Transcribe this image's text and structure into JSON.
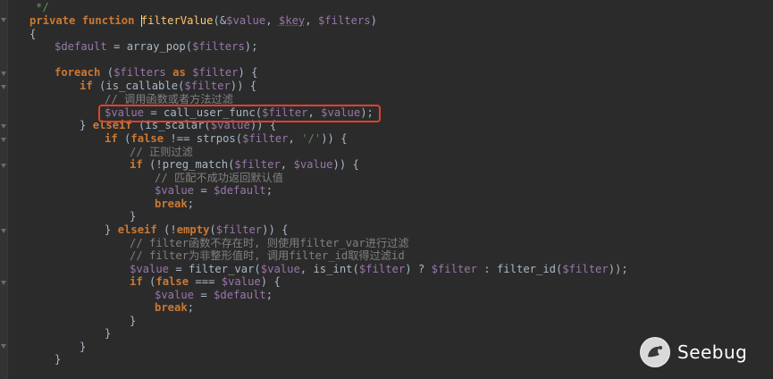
{
  "code": {
    "l0_comment_end": "*/",
    "l1_private": "private",
    "l1_function": "function",
    "l1_name": "filterValue",
    "l1_open": "(&",
    "l1_value": "$value",
    "l1_comma1": ", ",
    "l1_key": "$key",
    "l1_comma2": ", ",
    "l1_filters": "$filters",
    "l1_close": ")",
    "l2_brace": "{",
    "l3_default": "$default",
    "l3_assign": " = array_pop(",
    "l3_filters": "$filters",
    "l3_end": ");",
    "l4_foreach": "foreach",
    "l4_open": " (",
    "l4_filters": "$filters",
    "l4_as": " as ",
    "l4_filter": "$filter",
    "l4_end": ") {",
    "l5_if": "if",
    "l5_open": " (is_callable(",
    "l5_filter": "$filter",
    "l5_end": ")) {",
    "l6_comment": "// 调用函数或者方法过滤",
    "l7_value": "$value",
    "l7_mid": " = call_user_func(",
    "l7_filter": "$filter",
    "l7_comma": ", ",
    "l7_value2": "$value",
    "l7_end": ");",
    "l8_brace": "} ",
    "l8_elseif": "elseif",
    "l8_open": " (is_scalar(",
    "l8_value": "$value",
    "l8_end": ")) {",
    "l9_if": "if",
    "l9_open": " (",
    "l9_false": "false",
    "l9_mid": " !== strpos(",
    "l9_filter": "$filter",
    "l9_comma": ", ",
    "l9_str": "'/'",
    "l9_end": ")) {",
    "l10_comment": "// 正则过滤",
    "l11_if": "if",
    "l11_open": " (!preg_match(",
    "l11_filter": "$filter",
    "l11_comma": ", ",
    "l11_value": "$value",
    "l11_end": ")) {",
    "l12_comment": "// 匹配不成功返回默认值",
    "l13_value": "$value",
    "l13_mid": " = ",
    "l13_default": "$default",
    "l13_end": ";",
    "l14_break": "break",
    "l14_end": ";",
    "l15_brace": "}",
    "l16_brace": "} ",
    "l16_elseif": "elseif",
    "l16_open": " (!",
    "l16_empty": "empty",
    "l16_paren": "(",
    "l16_filter": "$filter",
    "l16_end": ")) {",
    "l17_comment": "// filter函数不存在时, 则使用filter_var进行过滤",
    "l18_comment": "// filter为非整形值时, 调用filter_id取得过滤id",
    "l19_value": "$value",
    "l19_mid": " = filter_var(",
    "l19_value2": "$value",
    "l19_mid2": ", is_int(",
    "l19_filter": "$filter",
    "l19_mid3": ") ? ",
    "l19_filter2": "$filter",
    "l19_mid4": " : filter_id(",
    "l19_filter3": "$filter",
    "l19_end": "));",
    "l20_if": "if",
    "l20_open": " (",
    "l20_false": "false",
    "l20_mid": " === ",
    "l20_value": "$value",
    "l20_end": ") {",
    "l21_value": "$value",
    "l21_mid": " = ",
    "l21_default": "$default",
    "l21_end": ";",
    "l22_break": "break",
    "l22_end": ";",
    "l23_brace": "}",
    "l24_brace": "}",
    "l25_brace": "}",
    "l26_brace": "}"
  },
  "logo": {
    "text": "Seebug"
  },
  "colors": {
    "background": "#2b2b2b",
    "keyword": "#cc7832",
    "function_name": "#ffc66d",
    "variable": "#9876aa",
    "string": "#6a8759",
    "comment": "#808080",
    "plain": "#a9b7c6",
    "highlight_box": "#e0412b"
  }
}
